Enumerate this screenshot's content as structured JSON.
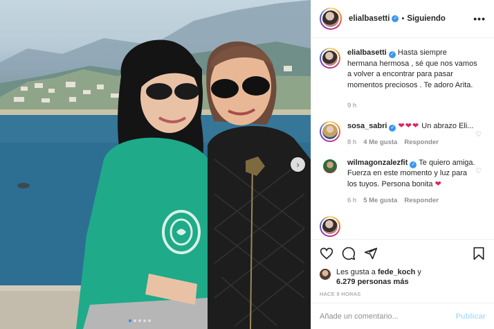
{
  "post": {
    "username": "elialbasetti",
    "follow_status": "Siguiendo",
    "separator": "•",
    "more_label": "•••",
    "caption": "Hasta siempre hermana hermosa , sé que nos vamos a volver a encontrar para pasar momentos preciosos . Te adoro Arita.",
    "caption_time": "9 h"
  },
  "comments": [
    {
      "username": "sosa_sabri",
      "hearts": "❤❤❤",
      "text": "Un abrazo Eli...",
      "time": "8 h",
      "likes": "4 Me gusta",
      "reply": "Responder"
    },
    {
      "username": "wilmagonzalezfit",
      "text": "Te quiero amiga. Fuerza en este momento y luz para los tuyos. Persona bonita",
      "hearts": "❤",
      "time": "6 h",
      "likes": "5 Me gusta",
      "reply": "Responder"
    }
  ],
  "likes": {
    "prefix": "Les gusta a",
    "user": "fede_koch",
    "conj": "y",
    "count": "6.279 personas más"
  },
  "timestamp": "HACE 9 HORAS",
  "add_comment": {
    "placeholder": "Añade un comentario...",
    "publish": "Publicar"
  },
  "icons": {
    "verified": "verified-badge-icon",
    "like": "heart-icon",
    "comment": "comment-icon",
    "share": "share-icon",
    "save": "bookmark-icon",
    "next": "chevron-right-icon",
    "comment_like": "heart-outline-icon"
  },
  "colors": {
    "verified": "#3897f0",
    "heart": "#e0245e",
    "publish_disabled": "#b2dffc",
    "carousel_active": "#2f8df0"
  },
  "carousel": {
    "total_dots": 5,
    "active_index": 0
  }
}
